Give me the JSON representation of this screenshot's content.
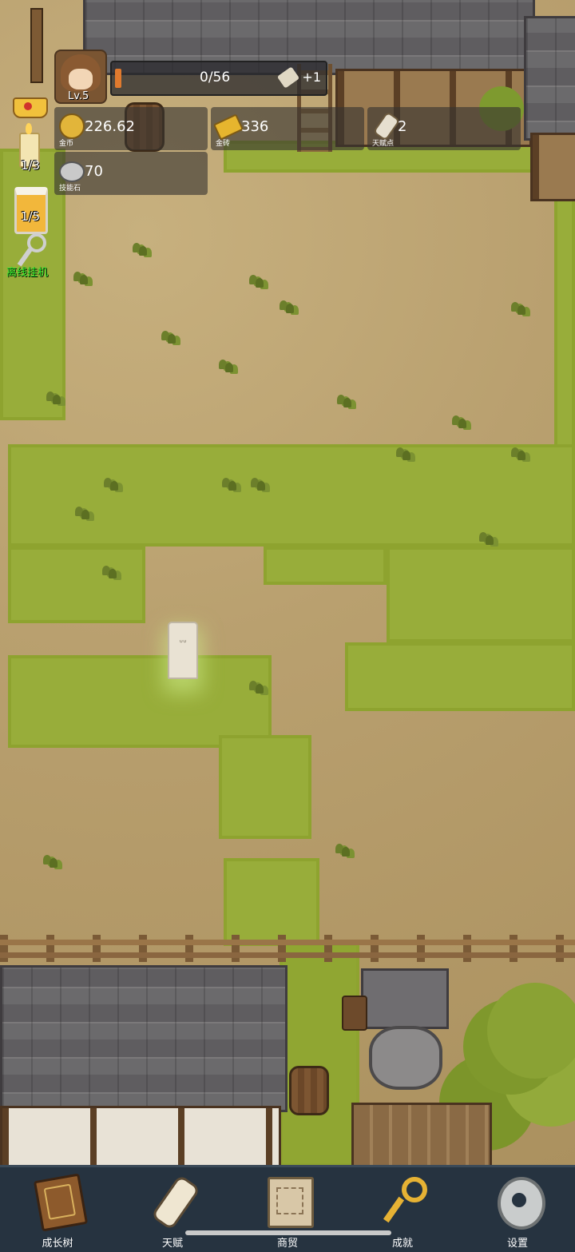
{
  "player": {
    "level_label": "Lv.5",
    "xp_text": "0/56",
    "xp_progress": 0.02,
    "xp_bonus": "+1",
    "bonus_icon": "scroll-icon"
  },
  "resources": [
    {
      "value": "226.62",
      "caption": "金币",
      "icon": "gold-coin-icon",
      "color": "#e2b53a"
    },
    {
      "value": "336",
      "caption": "金砖",
      "icon": "gold-bar-icon",
      "color": "#e6b52e"
    },
    {
      "value": "2",
      "caption": "天赋点",
      "icon": "talent-scroll-icon",
      "color": "#e6dfcf"
    },
    {
      "value": "70",
      "caption": "技能石",
      "icon": "skill-stone-icon",
      "color": "#bdbdbd"
    }
  ],
  "side": {
    "candle_count": "1/3",
    "beer_count": "1/5",
    "idle_label": "离线挂机"
  },
  "nav": [
    {
      "label": "成长树",
      "icon": "book-icon"
    },
    {
      "label": "天赋",
      "icon": "scroll-icon"
    },
    {
      "label": "商贸",
      "icon": "map-icon"
    },
    {
      "label": "成就",
      "icon": "key-icon"
    },
    {
      "label": "设置",
      "icon": "gear-icon"
    }
  ],
  "colors": {
    "grass": "#98ad3a",
    "dirt": "#b9a06f",
    "navbar": "#263340",
    "accent_green": "#2bea2b"
  }
}
